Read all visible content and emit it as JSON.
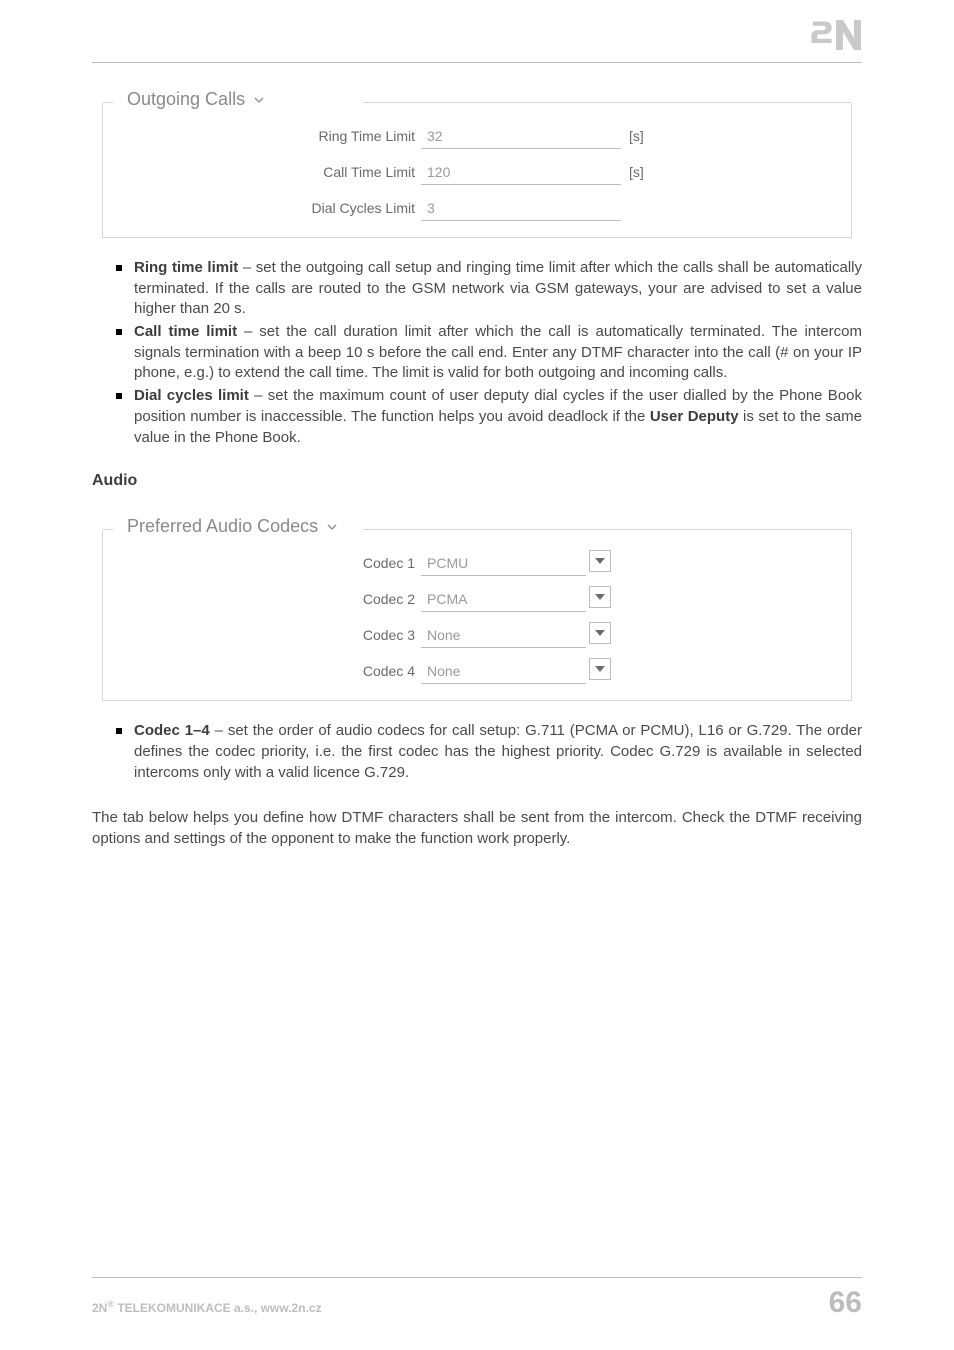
{
  "logo": {
    "text": "2N"
  },
  "groups": {
    "outgoing": {
      "legend": "Outgoing Calls",
      "rows": [
        {
          "label": "Ring Time Limit",
          "value": "32",
          "unit": "[s]"
        },
        {
          "label": "Call Time Limit",
          "value": "120",
          "unit": "[s]"
        },
        {
          "label": "Dial Cycles Limit",
          "value": "3",
          "unit": ""
        }
      ]
    },
    "codecs": {
      "legend": "Preferred Audio Codecs",
      "rows": [
        {
          "label": "Codec 1",
          "value": "PCMU"
        },
        {
          "label": "Codec 2",
          "value": "PCMA"
        },
        {
          "label": "Codec 3",
          "value": "None"
        },
        {
          "label": "Codec 4",
          "value": "None"
        }
      ]
    }
  },
  "bullets": {
    "first": [
      {
        "term": "Ring time limit",
        "text": " – set the outgoing call setup and ringing time limit after which the calls shall be automatically terminated. If the calls are routed to the GSM network via GSM gateways, your are advised to set a value higher than 20 s."
      },
      {
        "term": "Call time limit",
        "text": " – set the call duration limit after which the call is automatically terminated. The intercom signals termination with a beep 10 s before the call end. Enter any DTMF character into the call (# on your IP phone, e.g.) to extend the call time. The limit is valid for both outgoing and incoming calls."
      },
      {
        "term": "Dial cycles limit",
        "text_before": " – set the maximum count of user deputy dial cycles if the user dialled by the Phone Book position number is inaccessible. The function helps you avoid deadlock if the ",
        "term2": "User Deputy",
        "text_after": " is set to the same value in the Phone Book."
      }
    ],
    "second": [
      {
        "term": "Codec 1–4",
        "text": " – set the order of audio codecs for call setup: G.711 (PCMA or PCMU), L16 or G.729. The order defines the codec priority, i.e. the first codec has the highest priority. Codec G.729 is available in selected intercoms only with a valid licence G.729."
      }
    ]
  },
  "sections": {
    "audio_title": "Audio",
    "dtmf_para": "The tab below helps you define how DTMF characters shall be sent from the intercom. Check the DTMF receiving options and settings of the opponent to make the function work properly."
  },
  "footer": {
    "left_prefix": "2N",
    "left_sup": "®",
    "left_rest": " TELEKOMUNIKACE a.s., www.2n.cz",
    "page": "66"
  }
}
